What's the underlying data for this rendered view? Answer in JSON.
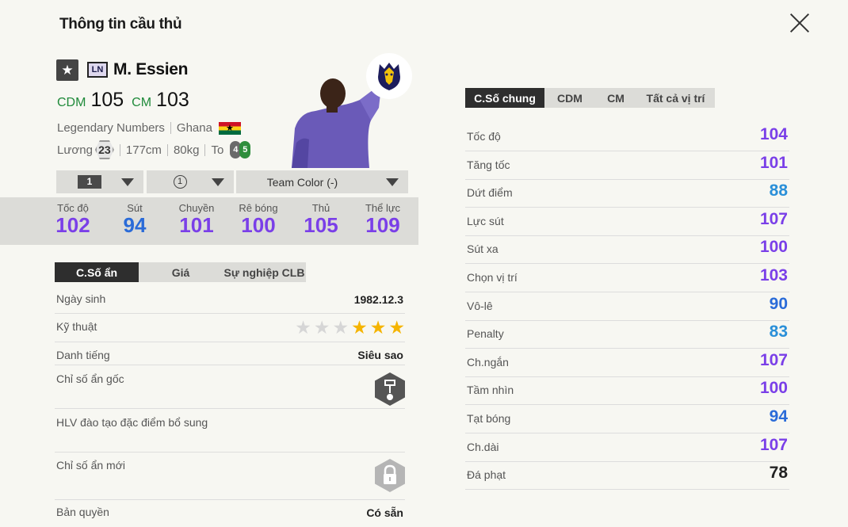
{
  "title": "Thông tin cầu thủ",
  "player": {
    "season_badge": "LN",
    "name": "M. Essien",
    "positions": [
      {
        "code": "CDM",
        "ovr": "105"
      },
      {
        "code": "CM",
        "ovr": "103"
      }
    ],
    "season": "Legendary Numbers",
    "nation": "Ghana",
    "salary_label": "Lương",
    "salary": "23",
    "height": "177cm",
    "weight": "80kg",
    "body": "To",
    "weak_foot": "4",
    "strong_foot": "5"
  },
  "controls": {
    "upgrade_level": "1",
    "team_color_level": "1",
    "team_color_label": "Team Color (-)"
  },
  "summary_stats": [
    {
      "label": "Tốc độ",
      "value": "102",
      "color": "#7a3fe8"
    },
    {
      "label": "Sút",
      "value": "94",
      "color": "#2a6bd8"
    },
    {
      "label": "Chuyền",
      "value": "101",
      "color": "#7a3fe8"
    },
    {
      "label": "Rê bóng",
      "value": "100",
      "color": "#7a3fe8"
    },
    {
      "label": "Thủ",
      "value": "105",
      "color": "#7a3fe8"
    },
    {
      "label": "Thể lực",
      "value": "109",
      "color": "#7a3fe8"
    }
  ],
  "left_tabs": [
    "C.Số ẩn",
    "Giá",
    "Sự nghiệp CLB"
  ],
  "info": {
    "birth_label": "Ngày sinh",
    "birth": "1982.12.3",
    "skill_label": "Kỹ thuật",
    "skill_stars": 3,
    "skill_max": 6,
    "fame_label": "Danh tiếng",
    "fame": "Siêu sao",
    "orig_traits_label": "Chỉ số ẩn gốc",
    "coach_traits_label": "HLV đào tạo đặc điểm bổ sung",
    "new_traits_label": "Chỉ số ẩn mới",
    "license_label": "Bản quyền",
    "license": "Có sẵn"
  },
  "right_tabs": [
    "C.Số chung",
    "CDM",
    "CM",
    "Tất cả vị trí"
  ],
  "detail_stats": [
    {
      "label": "Tốc độ",
      "value": "104",
      "color": "#7a3fe8"
    },
    {
      "label": "Tăng tốc",
      "value": "101",
      "color": "#7a3fe8"
    },
    {
      "label": "Dứt điểm",
      "value": "88",
      "color": "#2a8fd8"
    },
    {
      "label": "Lực sút",
      "value": "107",
      "color": "#7a3fe8"
    },
    {
      "label": "Sút xa",
      "value": "100",
      "color": "#7a3fe8"
    },
    {
      "label": "Chọn vị trí",
      "value": "103",
      "color": "#7a3fe8"
    },
    {
      "label": "Vô-lê",
      "value": "90",
      "color": "#2a6bd8"
    },
    {
      "label": "Penalty",
      "value": "83",
      "color": "#2a8fd8"
    },
    {
      "label": "Ch.ngắn",
      "value": "107",
      "color": "#7a3fe8"
    },
    {
      "label": "Tầm nhìn",
      "value": "100",
      "color": "#7a3fe8"
    },
    {
      "label": "Tạt bóng",
      "value": "94",
      "color": "#2a6bd8"
    },
    {
      "label": "Ch.dài",
      "value": "107",
      "color": "#7a3fe8"
    },
    {
      "label": "Đá phạt",
      "value": "78",
      "color": "#222222"
    }
  ]
}
